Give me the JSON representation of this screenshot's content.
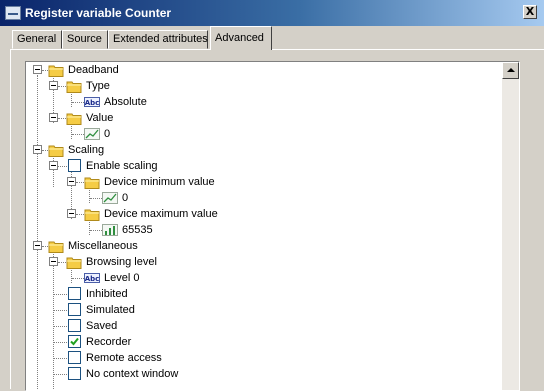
{
  "window": {
    "title": "Register variable Counter",
    "close_label": "X"
  },
  "tabs": [
    {
      "label": "General"
    },
    {
      "label": "Source"
    },
    {
      "label": "Extended attributes"
    },
    {
      "label": "Advanced",
      "active": true
    }
  ],
  "tree": {
    "deadband": {
      "label": "Deadband",
      "type": {
        "label": "Type",
        "value": "Absolute"
      },
      "value": {
        "label": "Value",
        "value": "0"
      }
    },
    "scaling": {
      "label": "Scaling",
      "enable": {
        "label": "Enable scaling",
        "checked": false
      },
      "min": {
        "label": "Device minimum value",
        "value": "0"
      },
      "max": {
        "label": "Device maximum value",
        "value": "65535"
      }
    },
    "misc": {
      "label": "Miscellaneous",
      "browsing": {
        "label": "Browsing level",
        "value": "Level 0"
      },
      "inhibited": {
        "label": "Inhibited",
        "checked": false
      },
      "simulated": {
        "label": "Simulated",
        "checked": false
      },
      "saved": {
        "label": "Saved",
        "checked": false
      },
      "recorder": {
        "label": "Recorder",
        "checked": true
      },
      "remote": {
        "label": "Remote access",
        "checked": false
      },
      "nocontext": {
        "label": "No context window",
        "checked": false
      }
    }
  },
  "colors": {
    "titlebar": "#0a246a",
    "folder": "#f5cc45",
    "check": "#21a121"
  },
  "icons": {
    "folder": "folder-icon",
    "text": "abc-text-icon",
    "value": "numeric-value-icon",
    "expander": "collapse-icon"
  }
}
